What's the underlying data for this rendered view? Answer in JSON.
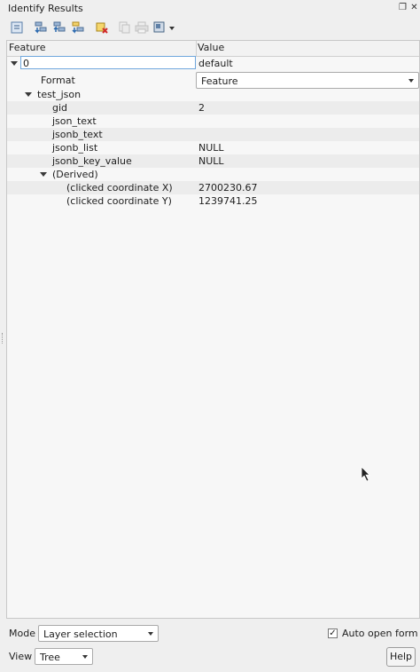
{
  "window": {
    "title": "Identify Results",
    "float_glyph": "❐",
    "close_glyph": "✕"
  },
  "toolbar": {
    "icons": [
      {
        "name": "expand-tree-icon",
        "enabled": true
      },
      {
        "name": "expand-all-icon",
        "enabled": true
      },
      {
        "name": "collapse-all-icon",
        "enabled": true
      },
      {
        "name": "expand-new-results-icon",
        "enabled": true
      },
      {
        "name": "clear-results-icon",
        "enabled": true
      },
      {
        "name": "copy-feature-icon",
        "enabled": false
      },
      {
        "name": "print-icon",
        "enabled": false
      },
      {
        "name": "identify-mode-icon",
        "enabled": true
      }
    ]
  },
  "table": {
    "headers": {
      "feature": "Feature",
      "value": "Value"
    },
    "root": {
      "label": "0",
      "value": "default"
    },
    "format": {
      "label": "Format",
      "value": "Feature"
    },
    "layer": {
      "label": "test_json"
    },
    "attributes": [
      {
        "name": "gid",
        "value": "2"
      },
      {
        "name": "json_text",
        "value": ""
      },
      {
        "name": "jsonb_text",
        "value": ""
      },
      {
        "name": "jsonb_list",
        "value": "NULL"
      },
      {
        "name": "jsonb_key_value",
        "value": "NULL"
      }
    ],
    "derived": {
      "label": "(Derived)",
      "items": [
        {
          "name": "(clicked coordinate X)",
          "value": "2700230.67"
        },
        {
          "name": "(clicked coordinate Y)",
          "value": "1239741.25"
        }
      ]
    }
  },
  "bottom": {
    "mode_label": "Mode",
    "mode_value": "Layer selection",
    "auto_open_label": "Auto open form",
    "auto_open_checked": true,
    "check_glyph": "✓",
    "view_label": "View",
    "view_value": "Tree",
    "help_label": "Help"
  }
}
